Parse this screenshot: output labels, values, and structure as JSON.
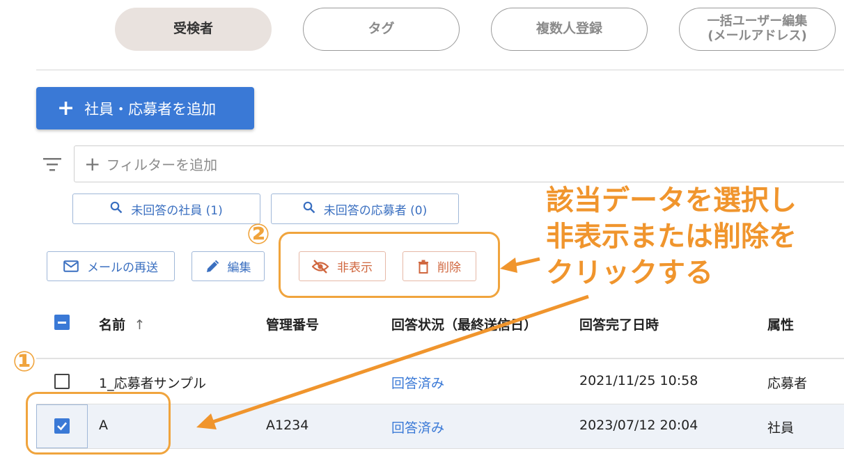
{
  "tabs": [
    {
      "label": "受検者",
      "active": true
    },
    {
      "label": "タグ",
      "active": false
    },
    {
      "label": "複数人登録",
      "active": false
    },
    {
      "label": "一括ユーザー編集\n(メールアドレス)",
      "active": false
    }
  ],
  "add_button": {
    "label": "社員・応募者を追加",
    "icon": "plus-icon"
  },
  "filter": {
    "placeholder": "フィルターを追加",
    "icon": "filter-list-icon"
  },
  "quick_filters": [
    {
      "label": "未回答の社員 (1)",
      "icon": "search-icon"
    },
    {
      "label": "未回答の応募者 (0)",
      "icon": "search-icon"
    }
  ],
  "actions": {
    "resend": "メールの再送",
    "edit": "編集",
    "hide": "非表示",
    "delete": "削除"
  },
  "table": {
    "headers": [
      "名前",
      "管理番号",
      "回答状況（最終送信日）",
      "回答完了日時",
      "属性"
    ],
    "sort_indicator": "↑",
    "rows": [
      {
        "name": "1_応募者サンプル",
        "id": "",
        "status": "回答済み",
        "completed": "2021/11/25 10:58",
        "type": "応募者",
        "checked": false
      },
      {
        "name": "A",
        "id": "A1234",
        "status": "回答済み",
        "completed": "2023/07/12 20:04",
        "type": "社員",
        "checked": true
      }
    ]
  },
  "annotations": {
    "instruction_lines": [
      "該当データを選択し",
      "非表示または削除を",
      "クリックする"
    ],
    "step1": "①",
    "step2": "②"
  },
  "colors": {
    "accent": "#3a79d6",
    "annotation": "#f0952d",
    "warn": "#d0673f",
    "tab_active_bg": "#e9e2de"
  }
}
